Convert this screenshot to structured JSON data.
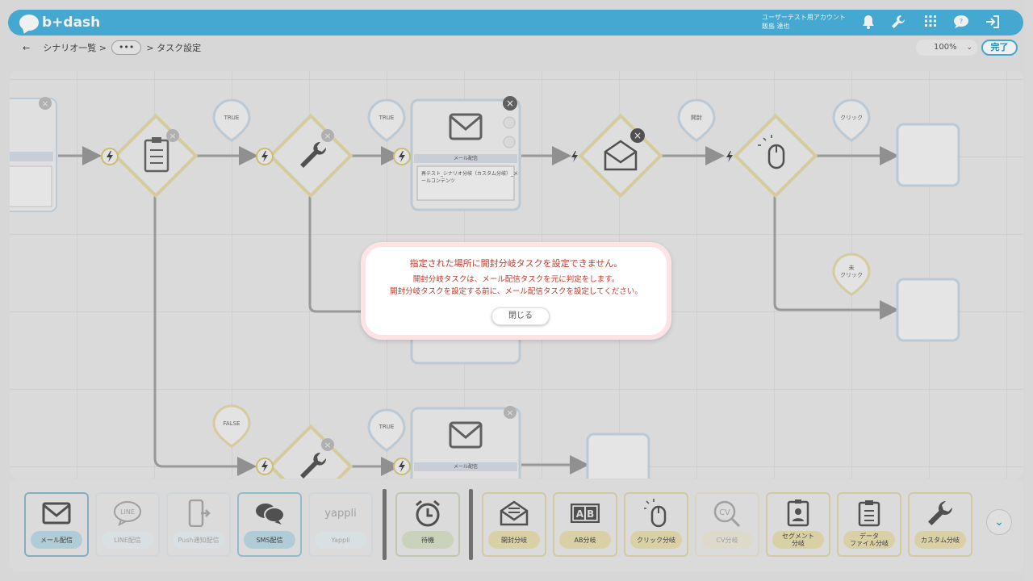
{
  "header": {
    "logo_text": "b+dash",
    "user_account": "ユーザーテスト用アカウント",
    "user_name": "飯島 達也",
    "icons": [
      "bell-icon",
      "wrench-icon",
      "apps-grid-icon",
      "support-chat-icon",
      "logout-icon"
    ]
  },
  "breadcrumb": {
    "back_icon": "←",
    "item1": "シナリオ一覧 >",
    "more": "•••",
    "item2": "> タスク設定"
  },
  "zoom": {
    "value": "100%",
    "chevron": "⌄"
  },
  "done_label": "完了",
  "canvas": {
    "pins": {
      "true1": "TRUE",
      "true2": "TRUE",
      "opened": "開封",
      "click": "クリック",
      "not_click": "未\nクリック",
      "false": "FALSE",
      "true3": "TRUE"
    },
    "mail_node_1": {
      "title": "メール配信",
      "description": "再テスト_シナリオ分岐（カスタム分岐）_メールコンテンツ"
    },
    "mail_node_2": {
      "title": "メール配信"
    }
  },
  "toolbox": {
    "items": [
      {
        "label": "メール配信",
        "icon": "mail-icon"
      },
      {
        "label": "LINE配信",
        "icon": "line-icon"
      },
      {
        "label": "Push通知配信",
        "icon": "push-phone-icon"
      },
      {
        "label": "SMS配信",
        "icon": "sms-icon"
      },
      {
        "label": "Yappli",
        "icon": "yappli-icon"
      },
      {
        "label": "待機",
        "icon": "alarm-clock-icon"
      },
      {
        "label": "開封分岐",
        "icon": "open-mail-icon"
      },
      {
        "label": "AB分岐",
        "icon": "ab-icon"
      },
      {
        "label": "クリック分岐",
        "icon": "mouse-icon"
      },
      {
        "label": "CV分岐",
        "icon": "cv-icon"
      },
      {
        "label": "セグメント\n分岐",
        "icon": "badge-icon"
      },
      {
        "label": "データ\nファイル分岐",
        "icon": "clipboard-icon"
      },
      {
        "label": "カスタム分岐",
        "icon": "wrench-icon"
      }
    ],
    "expand_icon": "⌄",
    "ab_icon_text": "A B",
    "yappli_icon_text": "yappli",
    "line_icon_text": "LINE",
    "cv_icon_text": "CV"
  },
  "modal": {
    "title": "指定された場所に開封分岐タスクを設定できません。",
    "line1": "開封分岐タスクは、メール配信タスクを元に判定をします。",
    "line2": "開封分岐タスクを設定する前に、メール配信タスクを設定してください。",
    "close_label": "閉じる"
  }
}
